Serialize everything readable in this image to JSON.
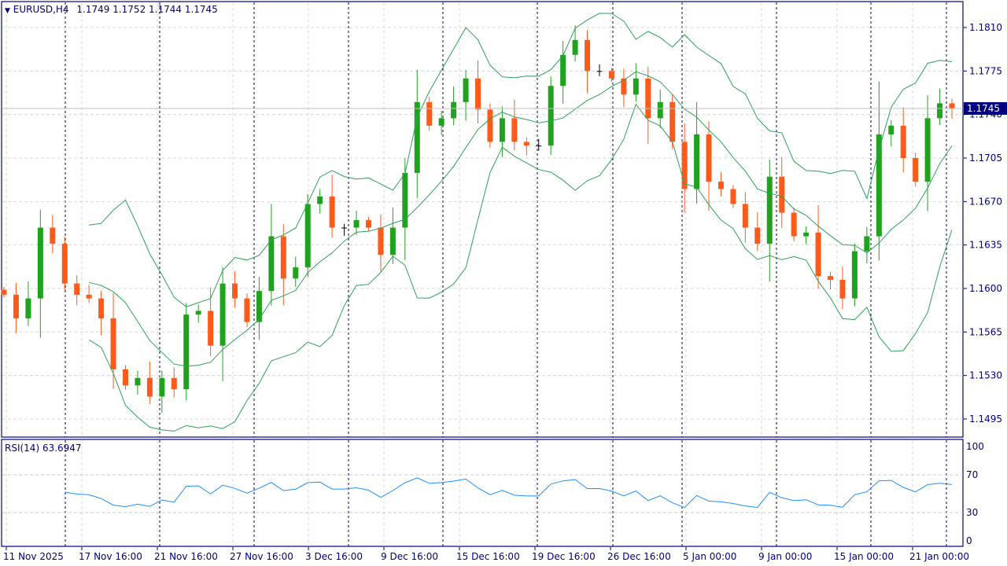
{
  "header": {
    "symbol": "EURUSD,H4",
    "ohlc": "1.1749 1.1752 1.1744 1.1745",
    "current_price": "1.1745"
  },
  "rsi_panel": {
    "label": "RSI(14) 63.6947",
    "levels": [
      "100",
      "70",
      "30",
      "0"
    ]
  },
  "colors": {
    "up": "#1fa31f",
    "down": "#ff5a1a",
    "bands": "#2ea05a",
    "rsi": "#1e90ff",
    "axis": "#000080"
  },
  "chart_data": {
    "type": "candlestick",
    "title": "EURUSD,H4",
    "y_ticks": [
      "1.1810",
      "1.1775",
      "1.1740",
      "1.1705",
      "1.1670",
      "1.1635",
      "1.1600",
      "1.1565",
      "1.1530",
      "1.1495"
    ],
    "ylim": [
      1.149,
      1.183
    ],
    "x_ticks": [
      "11 Nov 2025",
      "17 Nov 16:00",
      "21 Nov 16:00",
      "27 Nov 16:00",
      "3 Dec 16:00",
      "9 Dec 16:00",
      "15 Dec 16:00",
      "19 Dec 16:00",
      "26 Dec 16:00",
      "5 Jan 00:00",
      "9 Jan 00:00",
      "15 Jan 00:00",
      "21 Jan 00:00"
    ],
    "grid": true,
    "indicators": [
      "Bollinger Bands",
      "RSI(14)"
    ],
    "closes": [
      1.1595,
      1.1576,
      1.1592,
      1.1649,
      1.1636,
      1.1604,
      1.1595,
      1.1592,
      1.1576,
      1.1535,
      1.1522,
      1.1528,
      1.1513,
      1.1528,
      1.1519,
      1.1579,
      1.1582,
      1.1554,
      1.1604,
      1.1592,
      1.1573,
      1.1598,
      1.1642,
      1.1608,
      1.1617,
      1.1668,
      1.1674,
      1.1649,
      1.1649,
      1.1655,
      1.1649,
      1.1627,
      1.1649,
      1.1693,
      1.175,
      1.1731,
      1.1737,
      1.175,
      1.1769,
      1.1744,
      1.1718,
      1.1737,
      1.1718,
      1.1715,
      1.1715,
      1.1763,
      1.1788,
      1.18,
      1.1775,
      1.1775,
      1.1769,
      1.1756,
      1.1769,
      1.1737,
      1.175,
      1.1718,
      1.168,
      1.1724,
      1.1686,
      1.168,
      1.1668,
      1.1649,
      1.1636,
      1.169,
      1.1661,
      1.1642,
      1.1645,
      1.161,
      1.1607,
      1.1592,
      1.163,
      1.1642,
      1.1724,
      1.1731,
      1.1705,
      1.1686,
      1.1737,
      1.1749,
      1.1745
    ]
  }
}
